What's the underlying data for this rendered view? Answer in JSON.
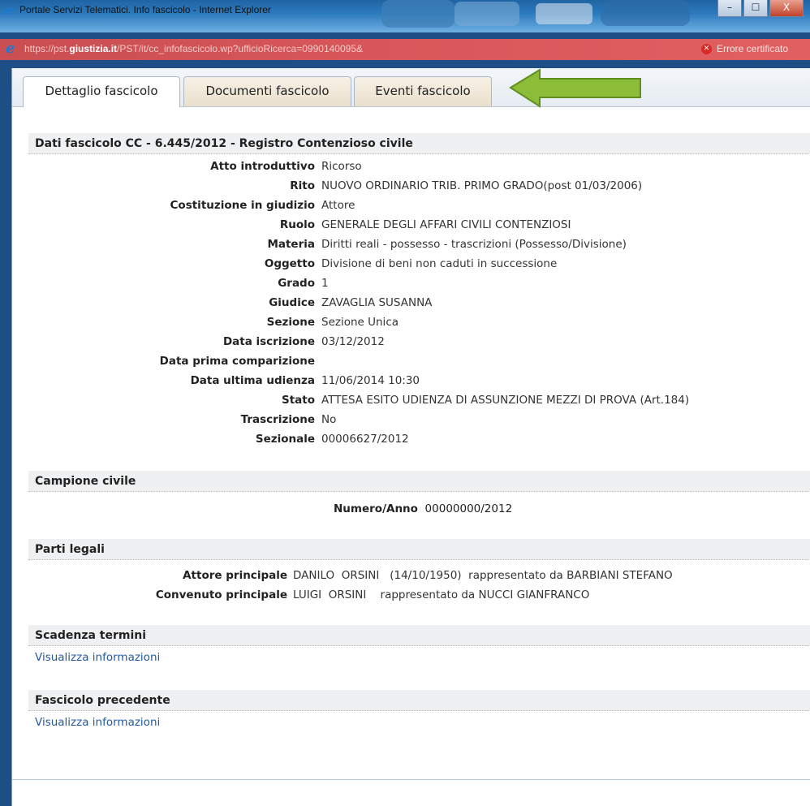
{
  "window": {
    "title": "Portale Servizi Telematici. Info fascicolo - Internet Explorer",
    "minimize_label": "–",
    "maximize_label": "☐",
    "close_label": "X"
  },
  "address": {
    "prefix": "https://pst.",
    "domain": "giustizia.it",
    "path": "/PST/it/cc_infofascicolo.wp?ufficioRicerca=0990140095&",
    "cert_error_label": "Errore certificato"
  },
  "tabs": [
    {
      "label": "Dettaglio fascicolo",
      "active": true
    },
    {
      "label": "Documenti fascicolo",
      "active": false
    },
    {
      "label": "Eventi fascicolo",
      "active": false
    }
  ],
  "dati_fascicolo": {
    "header": "Dati fascicolo  CC - 6.445/2012 - Registro  Contenzioso civile",
    "fields": [
      {
        "label": "Atto introduttivo",
        "value": "Ricorso"
      },
      {
        "label": "Rito",
        "value": "NUOVO ORDINARIO TRIB. PRIMO GRADO(post 01/03/2006)"
      },
      {
        "label": "Costituzione in giudizio",
        "value": "Attore"
      },
      {
        "label": "Ruolo",
        "value": "GENERALE DEGLI AFFARI CIVILI CONTENZIOSI"
      },
      {
        "label": "Materia",
        "value": "Diritti reali - possesso - trascrizioni (Possesso/Divisione)"
      },
      {
        "label": "Oggetto",
        "value": "Divisione di beni non caduti in successione"
      },
      {
        "label": "Grado",
        "value": "1"
      },
      {
        "label": "Giudice",
        "value": "ZAVAGLIA SUSANNA"
      },
      {
        "label": "Sezione",
        "value": "Sezione Unica"
      },
      {
        "label": "Data iscrizione",
        "value": "03/12/2012"
      },
      {
        "label": "Data prima comparizione",
        "value": ""
      },
      {
        "label": "Data ultima udienza",
        "value": "11/06/2014 10:30"
      },
      {
        "label": "Stato",
        "value": "ATTESA ESITO UDIENZA DI ASSUNZIONE MEZZI DI PROVA (Art.184)"
      },
      {
        "label": "Trascrizione",
        "value": "No"
      },
      {
        "label": "Sezionale",
        "value": "00006627/2012"
      }
    ]
  },
  "campione_civile": {
    "header": "Campione civile",
    "label": "Numero/Anno",
    "value": "00000000/2012"
  },
  "parti_legali": {
    "header": "Parti legali",
    "rows": [
      {
        "label": "Attore principale",
        "value": "DANILO  ORSINI   (14/10/1950)  rappresentato da BARBIANI STEFANO"
      },
      {
        "label": "Convenuto principale",
        "value": "LUIGI  ORSINI    rappresentato da NUCCI GIANFRANCO"
      }
    ]
  },
  "scadenza_termini": {
    "header": "Scadenza termini",
    "link": "Visualizza informazioni"
  },
  "fascicolo_precedente": {
    "header": "Fascicolo precedente",
    "link": "Visualizza informazioni"
  },
  "colors": {
    "arrow_fill": "#8cbd38",
    "arrow_stroke": "#5f8f1e",
    "section_bg": "#eef0f2",
    "link": "#245a9c",
    "address_bar": "#d9575a"
  },
  "icons": {
    "browser": "internet-explorer-icon",
    "cert": "error-icon",
    "annotation": "green-arrow-icon"
  }
}
